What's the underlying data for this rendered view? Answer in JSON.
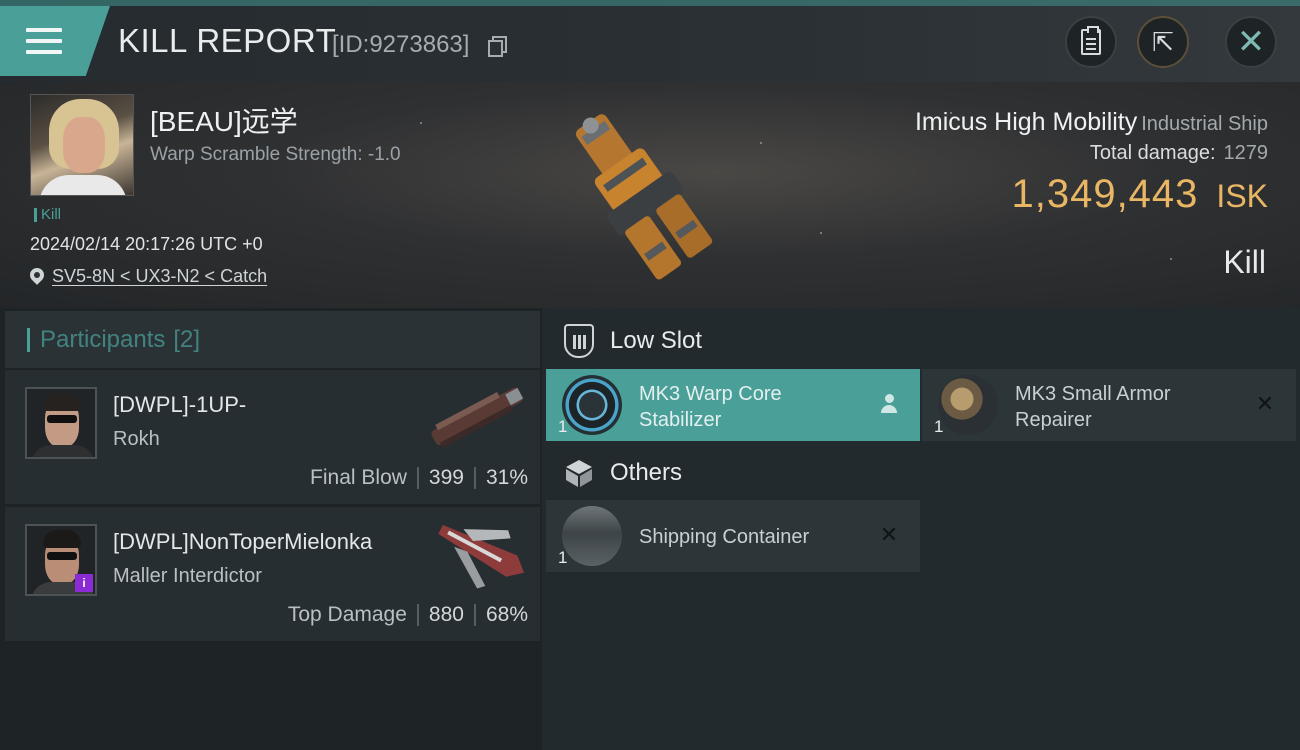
{
  "topbar": {
    "title": "KILL REPORT",
    "report_id": "[ID:9273863]",
    "icons": [
      "menu-icon",
      "copy-icon",
      "clipboard-icon",
      "share-icon",
      "close-icon"
    ]
  },
  "victim": {
    "name": "[BEAU]远学",
    "warp_scramble": "Warp Scramble Strength: -1.0",
    "tag": "Kill",
    "timestamp": "2024/02/14 20:17:26 UTC +0",
    "location": "SV5-8N < UX3-N2 < Catch"
  },
  "ship": {
    "name": "Imicus High Mobility",
    "class": "Industrial Ship",
    "total_damage_label": "Total damage:",
    "total_damage": "1279",
    "isk_value": "1,349,443",
    "isk_unit": "ISK",
    "result": "Kill"
  },
  "participants": {
    "title": "Participants",
    "count": "[2]",
    "items": [
      {
        "name": "[DWPL]-1UP-",
        "ship": "Rokh",
        "role": "Final Blow",
        "damage": "399",
        "percent": "31%"
      },
      {
        "name": "[DWPL]NonToperMielonka",
        "ship": "Maller Interdictor",
        "role": "Top Damage",
        "damage": "880",
        "percent": "68%"
      }
    ]
  },
  "items": {
    "low_slot_title": "Low Slot",
    "others_title": "Others",
    "low_slot": [
      {
        "name": "MK3 Warp Core Stabilizer",
        "qty": "1",
        "selected": true,
        "action": "person-icon"
      },
      {
        "name": "MK3 Small Armor Repairer",
        "qty": "1",
        "selected": false,
        "action": "close-icon"
      }
    ],
    "others": [
      {
        "name": "Shipping Container",
        "qty": "1",
        "action": "close-icon"
      }
    ]
  },
  "colors": {
    "accent": "#4a9f98",
    "isk": "#e9b764",
    "background": "#1c2124"
  }
}
